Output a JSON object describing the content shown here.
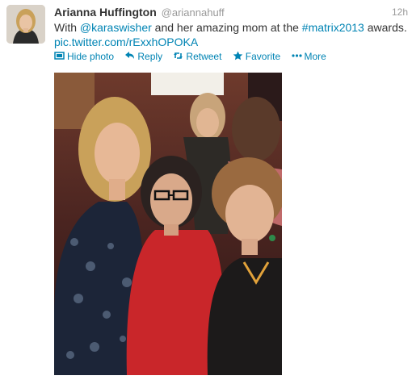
{
  "tweet": {
    "fullname": "Arianna Huffington",
    "username": "@ariannahuff",
    "time": "12h",
    "text_prefix": "With ",
    "mention": "@karaswisher",
    "text_middle": " and her amazing mom at the ",
    "hashtag": "#matrix2013",
    "text_suffix": " awards.",
    "photo_link": "pic.twitter.com/rExxhOPOKA"
  },
  "actions": {
    "hide_photo": "Hide photo",
    "reply": "Reply",
    "retweet": "Retweet",
    "favorite": "Favorite",
    "more": "More"
  },
  "icons": {
    "hide_photo": "photo-icon",
    "reply": "reply-arrow-icon",
    "retweet": "retweet-icon",
    "favorite": "star-icon",
    "more": "ellipsis-icon"
  },
  "colors": {
    "link": "#0084b4",
    "name": "#333333",
    "muted": "#999999"
  }
}
